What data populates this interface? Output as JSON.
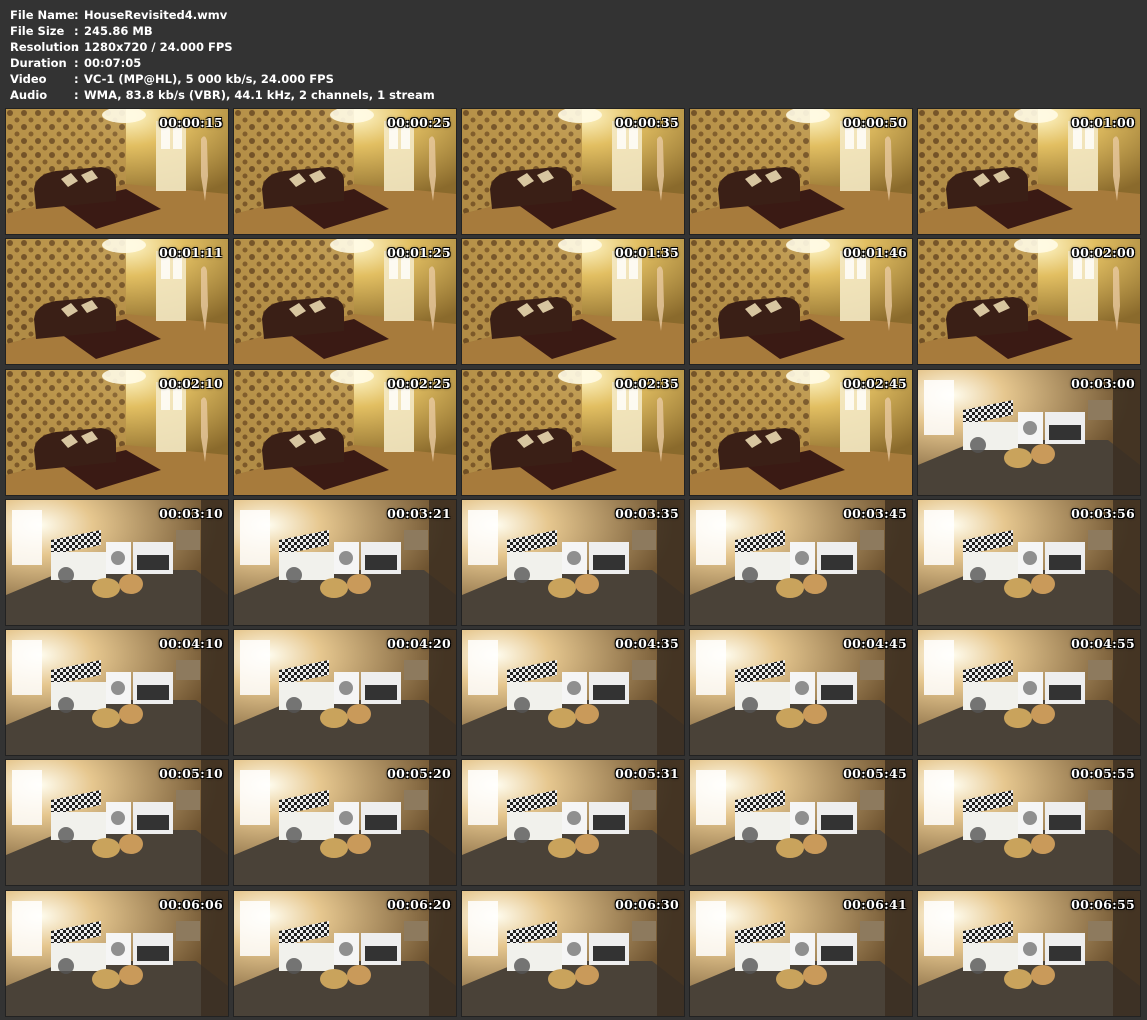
{
  "info": [
    {
      "label": "File Name",
      "value": "HouseRevisited4.wmv"
    },
    {
      "label": "File Size",
      "value": "245.86 MB"
    },
    {
      "label": "Resolution",
      "value": "1280x720 / 24.000 FPS"
    },
    {
      "label": "Duration",
      "value": "00:07:05"
    },
    {
      "label": "Video",
      "value": "VC-1 (MP@HL), 5 000 kb/s, 24.000 FPS"
    },
    {
      "label": "Audio",
      "value": "WMA, 83.8 kb/s (VBR), 44.1 kHz, 2 channels, 1 stream"
    }
  ],
  "separator": ":",
  "thumbnails": [
    {
      "time": "00:00:15",
      "scene": "living-room"
    },
    {
      "time": "00:00:25",
      "scene": "living-room"
    },
    {
      "time": "00:00:35",
      "scene": "living-room"
    },
    {
      "time": "00:00:50",
      "scene": "living-room"
    },
    {
      "time": "00:01:00",
      "scene": "living-room"
    },
    {
      "time": "00:01:11",
      "scene": "living-room"
    },
    {
      "time": "00:01:25",
      "scene": "living-room"
    },
    {
      "time": "00:01:35",
      "scene": "living-room"
    },
    {
      "time": "00:01:46",
      "scene": "living-room"
    },
    {
      "time": "00:02:00",
      "scene": "living-room"
    },
    {
      "time": "00:02:10",
      "scene": "living-room"
    },
    {
      "time": "00:02:25",
      "scene": "living-room"
    },
    {
      "time": "00:02:35",
      "scene": "living-room"
    },
    {
      "time": "00:02:45",
      "scene": "living-room"
    },
    {
      "time": "00:03:00",
      "scene": "kitchen"
    },
    {
      "time": "00:03:10",
      "scene": "kitchen"
    },
    {
      "time": "00:03:21",
      "scene": "kitchen"
    },
    {
      "time": "00:03:35",
      "scene": "kitchen"
    },
    {
      "time": "00:03:45",
      "scene": "kitchen"
    },
    {
      "time": "00:03:56",
      "scene": "kitchen"
    },
    {
      "time": "00:04:10",
      "scene": "kitchen"
    },
    {
      "time": "00:04:20",
      "scene": "kitchen"
    },
    {
      "time": "00:04:35",
      "scene": "kitchen"
    },
    {
      "time": "00:04:45",
      "scene": "kitchen"
    },
    {
      "time": "00:04:55",
      "scene": "kitchen"
    },
    {
      "time": "00:05:10",
      "scene": "kitchen"
    },
    {
      "time": "00:05:20",
      "scene": "kitchen"
    },
    {
      "time": "00:05:31",
      "scene": "kitchen"
    },
    {
      "time": "00:05:45",
      "scene": "kitchen"
    },
    {
      "time": "00:05:55",
      "scene": "kitchen"
    },
    {
      "time": "00:06:06",
      "scene": "kitchen"
    },
    {
      "time": "00:06:20",
      "scene": "kitchen"
    },
    {
      "time": "00:06:30",
      "scene": "kitchen"
    },
    {
      "time": "00:06:41",
      "scene": "kitchen"
    },
    {
      "time": "00:06:55",
      "scene": "kitchen"
    }
  ],
  "colors": {
    "background": "#333333",
    "text": "#ffffff",
    "wall_living": "#c9a24e",
    "floor_living": "#a77b3c",
    "sofa": "#3a1f16",
    "wall_kitchen": "#c8a470",
    "floor_kitchen": "#4a4238"
  }
}
